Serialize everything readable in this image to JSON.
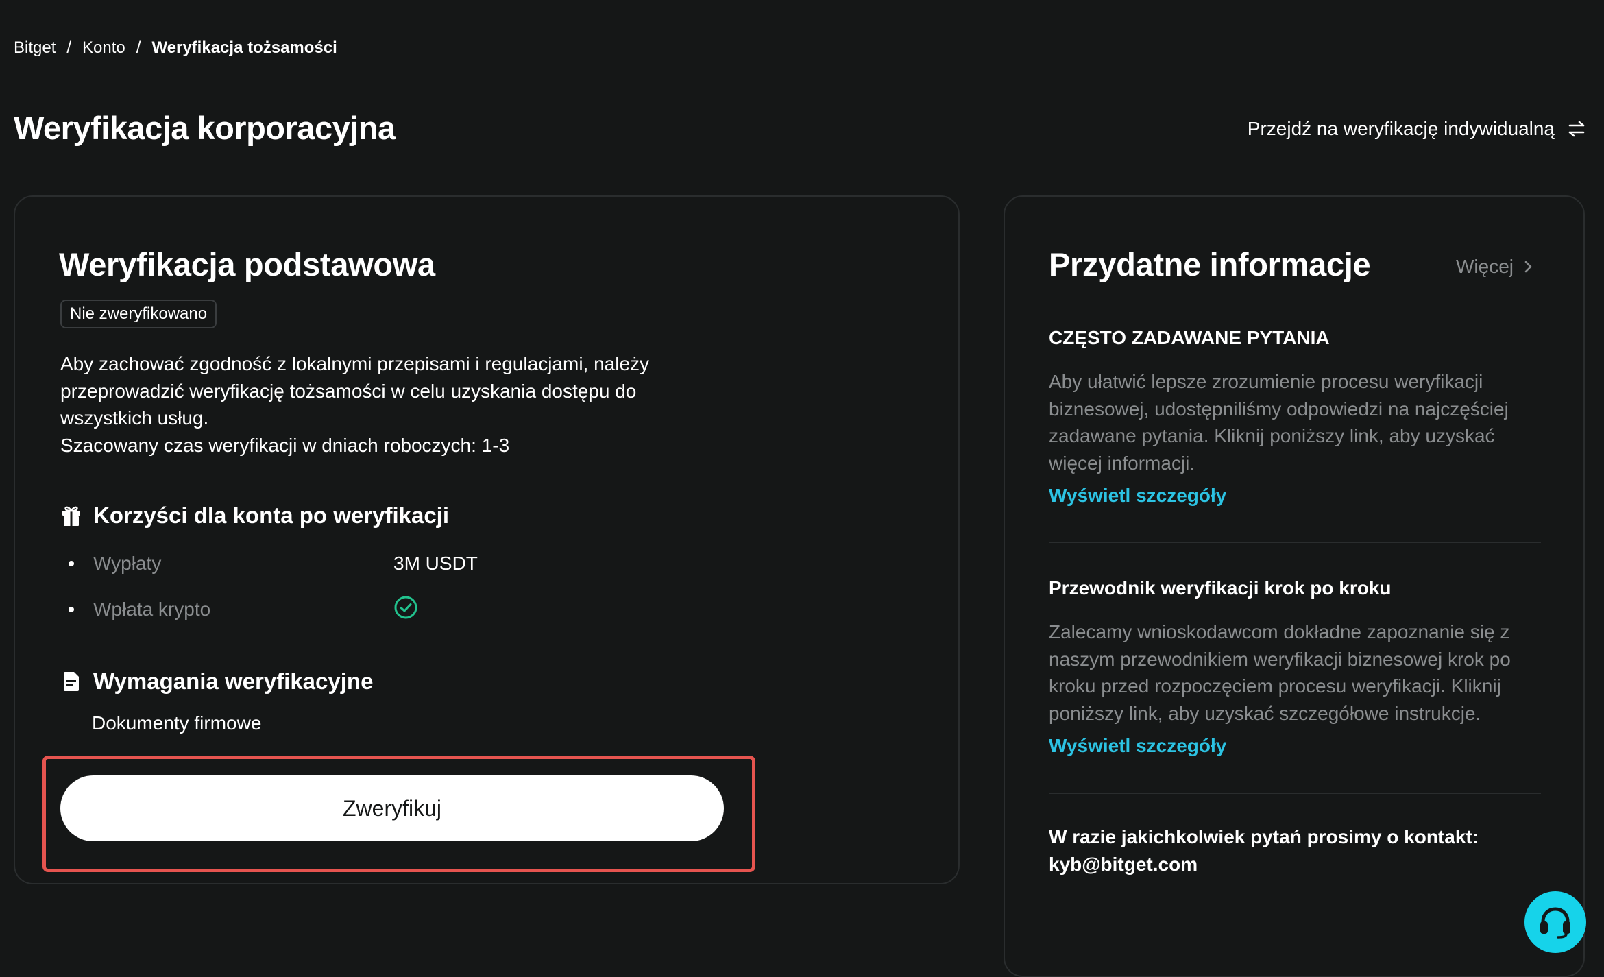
{
  "breadcrumb": {
    "items": [
      "Bitget",
      "Konto"
    ],
    "current": "Weryfikacja tożsamości",
    "separator": "/"
  },
  "page_title": "Weryfikacja korporacyjna",
  "switch_link": "Przejdź na weryfikację indywidualną",
  "main_card": {
    "title": "Weryfikacja podstawowa",
    "status_badge": "Nie zweryfikowano",
    "description_lines": [
      "Aby zachować zgodność z lokalnymi przepisami i regulacjami, należy",
      "przeprowadzić weryfikację tożsamości w celu uzyskania dostępu do",
      "wszystkich usług.",
      "Szacowany czas weryfikacji w dniach roboczych: 1-3"
    ],
    "benefits": {
      "heading": "Korzyści dla konta po weryfikacji",
      "icon": "gift-icon",
      "items": [
        {
          "label": "Wypłaty",
          "value": "3M USDT"
        },
        {
          "label": "Wpłata krypto",
          "value_icon": "check-circle-icon"
        }
      ]
    },
    "requirements": {
      "heading": "Wymagania weryfikacyjne",
      "icon": "document-icon",
      "text": "Dokumenty firmowe"
    },
    "verify_button": "Zweryfikuj"
  },
  "info_card": {
    "title": "Przydatne informacje",
    "more_link": "Więcej",
    "sections": [
      {
        "heading": "CZĘSTO ZADAWANE PYTANIA",
        "text_lines": [
          "Aby ułatwić lepsze zrozumienie procesu weryfikacji",
          "biznesowej, udostępniliśmy odpowiedzi na najczęściej",
          "zadawane pytania. Kliknij poniższy link, aby uzyskać",
          "więcej informacji."
        ],
        "link": "Wyświetl szczegóły"
      },
      {
        "heading": "Przewodnik weryfikacji krok po kroku",
        "text_lines": [
          "Zalecamy wnioskodawcom dokładne zapoznanie się z",
          "naszym przewodnikiem weryfikacji biznesowej krok po",
          "kroku przed rozpoczęciem procesu weryfikacji. Kliknij",
          "poniższy link, aby uzyskać szczegółowe instrukcje."
        ],
        "link": "Wyświetl szczegóły"
      }
    ],
    "contact_line": "W razie jakichkolwiek pytań prosimy o kontakt:",
    "contact_email": "kyb@bitget.com"
  },
  "support_icon": "headset-icon",
  "colors": {
    "background": "#151717",
    "accent_link": "#2cc3e3",
    "support_button": "#16d3ea",
    "success": "#22c38e",
    "highlight": "#e5544f",
    "muted_text": "#8a8d8f"
  }
}
